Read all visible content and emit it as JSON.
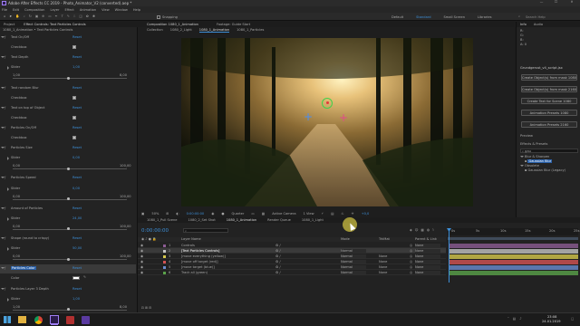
{
  "window": {
    "title": "Adobe After Effects CC 2019 - Photo_Animator_V2 (converted).aep *"
  },
  "menu": [
    "File",
    "Edit",
    "Composition",
    "Layer",
    "Effect",
    "Animation",
    "View",
    "Window",
    "Help"
  ],
  "toolbar": {
    "snapping": "Snapping"
  },
  "workspaces": [
    "Default",
    "Standard",
    "Small Screen",
    "Libraries"
  ],
  "search_help_placeholder": "Search Help",
  "effect_controls": {
    "header_tabs": [
      "Project",
      "Effect Controls: Text Particles Controls"
    ],
    "layer_path": "1080_1_Animation • Text Particles Controls",
    "rows": [
      {
        "name": "Text On/Off",
        "reset": "Reset"
      },
      {
        "name": "Checkbox",
        "type": "checkbox",
        "checked": true
      },
      {
        "name": "Text Depth",
        "reset": "Reset"
      },
      {
        "name": "Slider",
        "value": "1,00"
      },
      {
        "name": "1,00",
        "scale": "8,00",
        "type": "slider"
      },
      {
        "name": "Text random Blur",
        "reset": "Reset"
      },
      {
        "name": "Checkbox",
        "type": "checkbox",
        "checked": true
      },
      {
        "name": "Text on top of Object",
        "reset": "Reset"
      },
      {
        "name": "Checkbox",
        "type": "checkbox",
        "checked": true
      },
      {
        "name": "Particles On/Off",
        "reset": "Reset"
      },
      {
        "name": "Checkbox",
        "type": "checkbox",
        "checked": true
      },
      {
        "name": "Particles Size",
        "reset": "Reset"
      },
      {
        "name": "Slider",
        "value": "0,00"
      },
      {
        "name": "0,00",
        "scale": "100,00",
        "type": "slider"
      },
      {
        "name": "Particles Speed",
        "reset": "Reset"
      },
      {
        "name": "Slider",
        "value": "0,00"
      },
      {
        "name": "0,00",
        "scale": "100,00",
        "type": "slider"
      },
      {
        "name": "Amount of Particles",
        "reset": "Reset"
      },
      {
        "name": "Slider",
        "value": "24,00"
      },
      {
        "name": "0,00",
        "scale": "100,00",
        "type": "slider"
      },
      {
        "name": "Shape (round to crispy)",
        "reset": "Reset"
      },
      {
        "name": "Slider",
        "value": "50,00"
      },
      {
        "name": "0,00",
        "scale": "100,00",
        "type": "slider"
      },
      {
        "name": "Particles Color",
        "reset": "Reset",
        "selected": true
      },
      {
        "name": "Color",
        "type": "color"
      },
      {
        "name": "Particles Layer 3 Depth",
        "reset": "Reset"
      },
      {
        "name": "Slider",
        "value": "1,00"
      },
      {
        "name": "1,00",
        "scale": "8,00",
        "type": "slider"
      }
    ]
  },
  "composition_panel": {
    "tabs": [
      "Composition 1080_1_Animation",
      "Footage: Guide Start"
    ],
    "breadcrumbs": [
      "Collection",
      "1080_2_Light",
      "1080_1_Animation",
      "1080_1_Particles"
    ],
    "zoom": "50%",
    "timecode": "0:00:00:00",
    "resolution": "Quarter",
    "camera": "Active Camera",
    "views": "1 View",
    "offset": "+0,0"
  },
  "right_panel": {
    "tabs": [
      "Info",
      "Audio"
    ],
    "info_lines": [
      "R:",
      "G:",
      "B:",
      "A: 0"
    ],
    "script_tab": "Grundgerust_v4_script.jsx",
    "buttons": [
      "Create Object(s) from mask 1080",
      "Create Object(s) from mask 2160",
      "Create Text for Scene 1080",
      "Animation Presets 1080",
      "Animation Presets 2160"
    ],
    "preview_tab": "Preview",
    "effects_tab": "Effects & Presets",
    "search_value": "gau",
    "tree": [
      {
        "label": "Blur & Sharpen",
        "level": 0
      },
      {
        "label": "Gaussian Blur",
        "level": 1,
        "selected": true
      },
      {
        "label": "Obsolete",
        "level": 0
      },
      {
        "label": "Gaussian Blur (Legacy)",
        "level": 1
      }
    ]
  },
  "timeline": {
    "tabs": [
      "1080_1_Pull Scene",
      "1080_2_Set Shot",
      "1080_1_Animation",
      "Render Queue",
      "1080_1_Light"
    ],
    "timecode": "0:00:00:00",
    "columns": {
      "layer_name": "Layer Name",
      "mode": "Mode",
      "trkmat": "TrkMat",
      "parent": "Parent & Link"
    },
    "layers": [
      {
        "num": "1",
        "name": "Controls",
        "mode": "",
        "parent": "None",
        "color": "#8c5c94"
      },
      {
        "num": "2",
        "name": "[Text Particles Controls]",
        "mode": "Normal",
        "parent": "None",
        "color": "#c4c4c4",
        "selected": true
      },
      {
        "num": "3",
        "name": "[move everything (yellow)]",
        "mode": "Normal",
        "trkmat": "None",
        "parent": "None",
        "color": "#d6c84c"
      },
      {
        "num": "4",
        "name": "[move off target (red)]",
        "mode": "Normal",
        "trkmat": "None",
        "parent": "None",
        "color": "#d45454"
      },
      {
        "num": "5",
        "name": "[move target (blue)]",
        "mode": "Normal",
        "trkmat": "None",
        "parent": "None",
        "color": "#6a8dd0"
      },
      {
        "num": "6",
        "name": "Track all (green)",
        "mode": "Normal",
        "trkmat": "None",
        "parent": "None",
        "color": "#5aa24a"
      }
    ],
    "ruler": [
      "0s",
      "5s",
      "10s",
      "15s",
      "20s",
      "25s"
    ]
  },
  "taskbar": {
    "time": "23:08",
    "date": "24.01.2019"
  }
}
